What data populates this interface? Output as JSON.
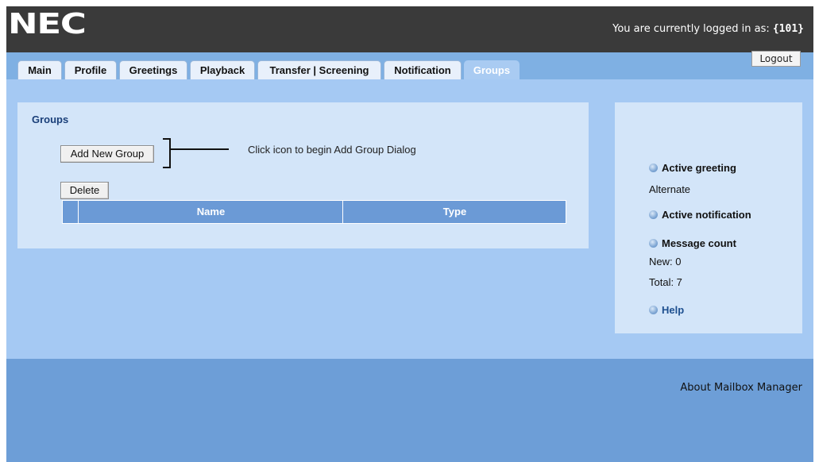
{
  "header": {
    "logo_text": "NEC",
    "login_prefix": "You are currently logged in as: ",
    "login_user": "{101}",
    "logout_label": "Logout"
  },
  "tabs": [
    {
      "label": "Main"
    },
    {
      "label": "Profile"
    },
    {
      "label": "Greetings"
    },
    {
      "label": "Playback"
    },
    {
      "label": "Transfer | Screening"
    },
    {
      "label": "Notification"
    },
    {
      "label": "Groups",
      "active": true
    }
  ],
  "groups": {
    "title": "Groups",
    "add_button": "Add New Group",
    "callout": "Click icon to begin Add Group Dialog",
    "delete_button": "Delete",
    "columns": [
      "Name",
      "Type"
    ]
  },
  "sidebar": {
    "active_greeting_label": "Active greeting",
    "active_greeting_value": "Alternate",
    "active_notification_label": "Active notification",
    "message_count_label": "Message count",
    "new_count": "New: 0",
    "total_count": "Total: 7",
    "help_label": "Help"
  },
  "footer": {
    "about_label": "About Mailbox Manager"
  },
  "colors": {
    "header_bg": "#3a3a3a",
    "tab_active": "#a9cbf2",
    "content_bg": "#a5c9f3",
    "panel_bg": "#d3e5f9",
    "grid_header": "#6b9ad6",
    "footer_bg": "#6d9ed7"
  }
}
